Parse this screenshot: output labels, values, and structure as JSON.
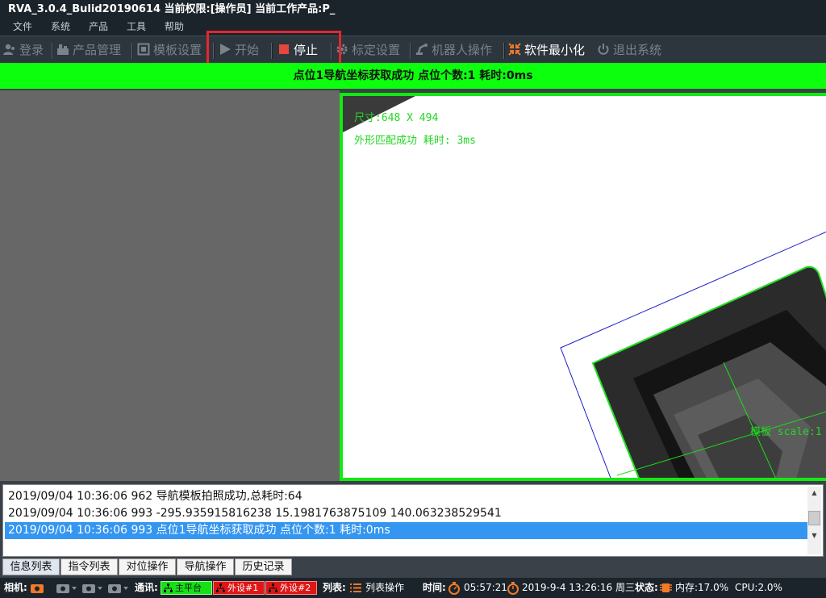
{
  "window": {
    "title": "RVA_3.0.4_Bulid20190614 当前权限:[操作员] 当前工作产品:P_"
  },
  "menu": [
    "文件",
    "系统",
    "产品",
    "工具",
    "帮助"
  ],
  "toolbar": {
    "login": "登录",
    "product_manage": "产品管理",
    "template_settings": "模板设置",
    "start": "开始",
    "stop": "停止",
    "calibration_settings": "标定设置",
    "robot_operation": "机器人操作",
    "minimize": "软件最小化",
    "exit": "退出系统"
  },
  "banner": {
    "text": "点位1导航坐标获取成功  点位个数:1     耗时:0ms",
    "color": "#0cff0c"
  },
  "viewer": {
    "size_text": "尺寸:648 X 494",
    "match_text": "外形匹配成功 耗时: 3ms",
    "template_text": "模板 scale:1"
  },
  "log": [
    "2019/09/04 10:36:06 962 导航模板拍照成功,总耗时:64",
    "2019/09/04 10:36:06 993 -295.935915816238 15.1981763875109 140.063238529541",
    "2019/09/04 10:36:06 993 点位1导航坐标获取成功 点位个数:1  耗时:0ms"
  ],
  "tabs": [
    "信息列表",
    "指令列表",
    "对位操作",
    "导航操作",
    "历史记录"
  ],
  "status": {
    "camera_label": "相机:",
    "comm_label": "通讯:",
    "main_platform": "主平台",
    "device1": "外设#1",
    "device2": "外设#2",
    "list_label": "列表:",
    "list_ops": "列表操作",
    "time_label": "时间:",
    "elapsed": "05:57:21",
    "datetime": "2019-9-4 13:26:16 周三",
    "state_label": "状态:",
    "memory": "内存:17.0%",
    "cpu": "CPU:2.0%"
  },
  "colors": {
    "accent_green": "#16e016",
    "error_red": "#e01515",
    "selection_blue": "#3496f0",
    "highlight_red": "#e5262e"
  }
}
